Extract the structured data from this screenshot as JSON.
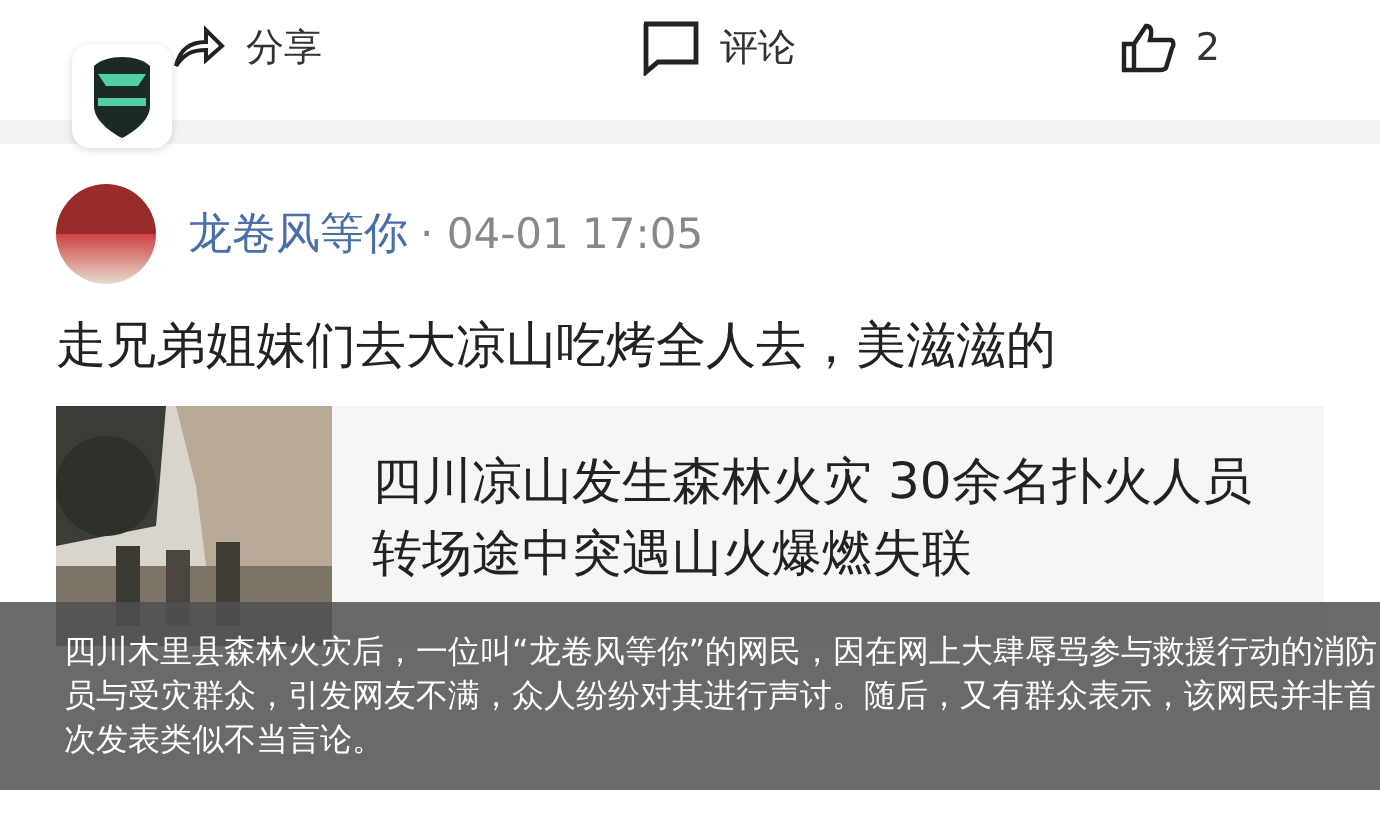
{
  "action_bar": {
    "share": "分享",
    "comment": "评论",
    "like_count": "2"
  },
  "post": {
    "author": "龙卷风等你",
    "time": "· 04-01 17:05",
    "text": "走兄弟姐妹们去大凉山吃烤全人去，美滋滋的",
    "shared_article": {
      "title": "四川凉山发生森林火灾 30余名扑火人员转场途中突遇山火爆燃失联"
    }
  },
  "caption": "四川木里县森林火灾后，一位叫“龙卷风等你”的网民，因在网上大肆辱骂参与救援行动的消防员与受灾群众，引发网友不满，众人纷纷对其进行声讨。随后，又有群众表示，该网民并非首次发表类似不当言论。"
}
